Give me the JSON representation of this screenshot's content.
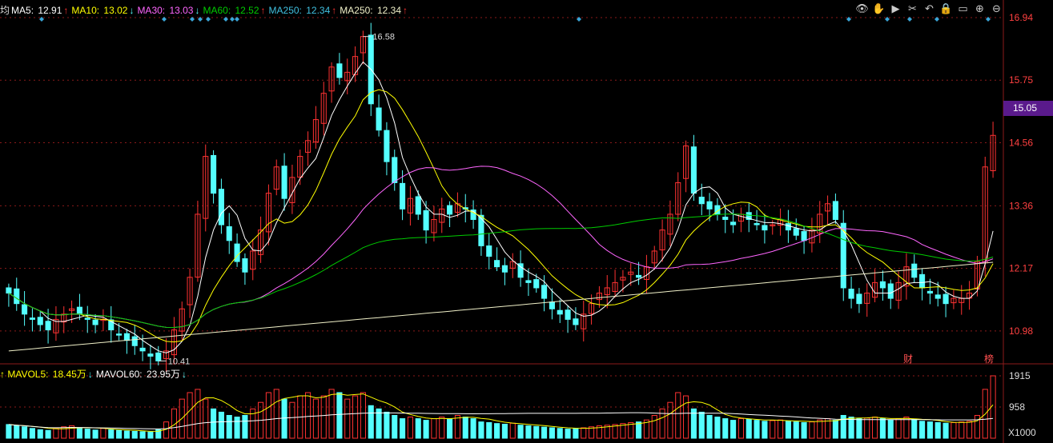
{
  "ma_legend": {
    "prefix": "均",
    "items": [
      {
        "label": "MA5: ",
        "value": "12.91",
        "arrow": "↑",
        "color": "#ffffff"
      },
      {
        "label": "MA10: ",
        "value": "13.02",
        "arrow": "↓",
        "color": "#ffff00"
      },
      {
        "label": "MA30: ",
        "value": "13.03",
        "arrow": "↓",
        "color": "#ff66ff"
      },
      {
        "label": "MA60: ",
        "value": "12.52",
        "arrow": "↑",
        "color": "#00cc00"
      },
      {
        "label": "MA250: ",
        "value": "12.34",
        "arrow": "↑",
        "color": "#40c0e0"
      },
      {
        "label": "MA250: ",
        "value": "12.34",
        "arrow": "↑",
        "color": "#f0f0c8"
      }
    ]
  },
  "vol_legend": {
    "items": [
      {
        "label": "↑ MAVOL5: ",
        "value": "18.45万",
        "arrow": "↓",
        "color": "#ffff00"
      },
      {
        "label": "MAVOL60: ",
        "value": "23.95万",
        "arrow": "↓",
        "color": "#ffffff"
      }
    ]
  },
  "toolbar": [
    {
      "name": "eye-icon",
      "glyph": "👁"
    },
    {
      "name": "hand-icon",
      "glyph": "✋"
    },
    {
      "name": "play-icon",
      "glyph": "▶"
    },
    {
      "name": "scissors-icon",
      "glyph": "✂"
    },
    {
      "name": "undo-icon",
      "glyph": "↶"
    },
    {
      "name": "lock-icon",
      "glyph": "🔒"
    },
    {
      "name": "minimize-icon",
      "glyph": "▭"
    },
    {
      "name": "zoom-in-icon",
      "glyph": "⊕"
    },
    {
      "name": "zoom-out-icon",
      "glyph": "⊖"
    }
  ],
  "price_axis": [
    "16.94",
    "15.75",
    "14.56",
    "13.36",
    "12.17",
    "10.98"
  ],
  "current_price": "15.05",
  "vol_axis": [
    "1915",
    "958",
    "X1000"
  ],
  "annotations": {
    "high": "16.58",
    "low": "10.41",
    "marker_cai": "财",
    "marker_bang": "榜"
  },
  "colors": {
    "up": "#ff3232",
    "down": "#54ffff",
    "ma5": "#ffffff",
    "ma10": "#ffff00",
    "ma30": "#ff66ff",
    "ma60": "#00cc00",
    "ma250": "#f0f0c8",
    "grid": "#8b1a1a"
  },
  "chart_data": {
    "type": "candlestick",
    "y_range": [
      10.4,
      16.94
    ],
    "closes": [
      11.7,
      11.5,
      11.3,
      11.2,
      11.1,
      11.0,
      11.2,
      11.3,
      11.4,
      11.3,
      11.2,
      11.1,
      11.2,
      11.0,
      10.9,
      10.8,
      10.7,
      10.6,
      10.5,
      10.41,
      10.6,
      11.0,
      11.4,
      12.0,
      13.2,
      14.3,
      13.6,
      13.0,
      12.7,
      12.3,
      12.1,
      12.5,
      12.9,
      13.6,
      14.1,
      13.5,
      13.9,
      14.3,
      14.6,
      15.0,
      15.5,
      16.0,
      15.8,
      15.9,
      16.2,
      16.58,
      15.3,
      14.8,
      14.2,
      13.8,
      13.3,
      13.5,
      13.2,
      12.9,
      13.1,
      13.3,
      13.2,
      13.4,
      13.3,
      13.1,
      12.6,
      12.4,
      12.2,
      12.1,
      12.3,
      12.0,
      11.9,
      11.8,
      11.6,
      11.4,
      11.3,
      11.2,
      11.1,
      11.3,
      11.5,
      11.7,
      11.8,
      11.9,
      12.0,
      12.1,
      12.0,
      12.2,
      12.5,
      12.9,
      13.2,
      13.8,
      14.5,
      13.6,
      13.4,
      13.3,
      13.2,
      13.1,
      13.0,
      13.2,
      13.1,
      13.0,
      12.9,
      13.0,
      13.1,
      12.9,
      12.8,
      12.7,
      12.9,
      13.2,
      13.4,
      13.1,
      11.8,
      11.6,
      11.5,
      11.7,
      11.9,
      11.8,
      11.6,
      11.9,
      12.2,
      12.0,
      11.8,
      11.7,
      11.6,
      11.5,
      11.6,
      11.6,
      11.7,
      12.3,
      14.1,
      14.7
    ],
    "volumes": [
      420,
      380,
      350,
      300,
      260,
      240,
      300,
      350,
      380,
      320,
      280,
      250,
      300,
      260,
      240,
      220,
      210,
      200,
      190,
      260,
      500,
      900,
      1200,
      1400,
      1500,
      1200,
      900,
      800,
      700,
      650,
      700,
      900,
      1100,
      1400,
      1500,
      1200,
      1100,
      1300,
      1400,
      1200,
      1300,
      1500,
      1400,
      1200,
      1300,
      1400,
      1000,
      900,
      800,
      700,
      600,
      650,
      600,
      550,
      600,
      650,
      600,
      700,
      650,
      600,
      500,
      480,
      450,
      430,
      460,
      400,
      380,
      360,
      340,
      320,
      300,
      280,
      300,
      320,
      350,
      380,
      400,
      420,
      450,
      480,
      500,
      560,
      700,
      900,
      1100,
      1400,
      1300,
      900,
      800,
      700,
      650,
      600,
      550,
      600,
      580,
      550,
      520,
      540,
      560,
      520,
      500,
      480,
      500,
      560,
      600,
      550,
      700,
      650,
      600,
      620,
      650,
      600,
      550,
      600,
      650,
      580,
      520,
      500,
      480,
      460,
      480,
      500,
      520,
      700,
      1500,
      1915
    ],
    "price_ticks": [
      16.94,
      15.75,
      14.56,
      13.36,
      12.17,
      10.98
    ],
    "volume_ticks": [
      1915,
      958
    ],
    "volume_unit": "X1000"
  }
}
